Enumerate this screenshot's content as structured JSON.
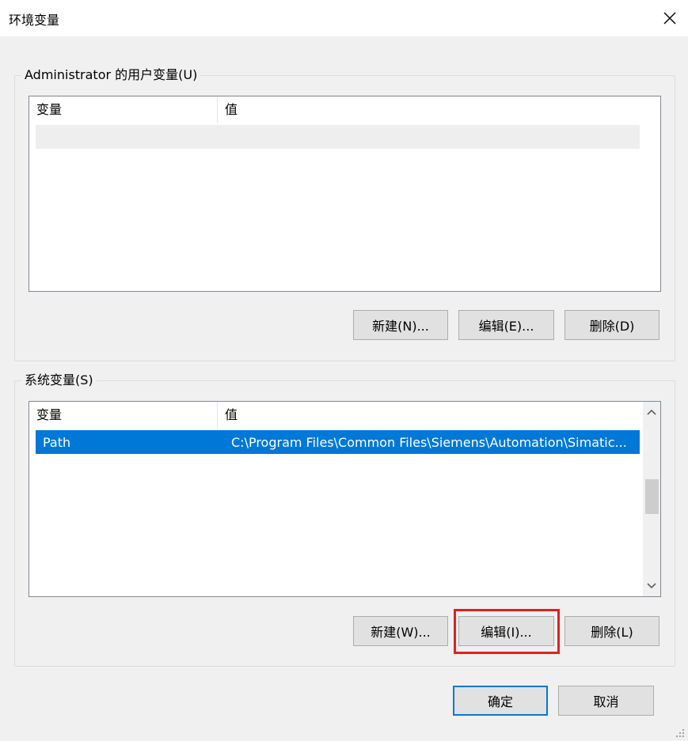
{
  "window": {
    "title": "环境变量",
    "close_icon": "close-icon"
  },
  "user_vars": {
    "group_label": "Administrator 的用户变量(U)",
    "columns": [
      "变量",
      "值"
    ],
    "rows": [],
    "buttons": {
      "new": "新建(N)...",
      "edit": "编辑(E)...",
      "delete": "删除(D)"
    }
  },
  "system_vars": {
    "group_label": "系统变量(S)",
    "columns": [
      "变量",
      "值"
    ],
    "selected_row": {
      "name": "Path",
      "value": "C:\\Program Files\\Common Files\\Siemens\\Automation\\Simatic..."
    },
    "buttons": {
      "new": "新建(W)...",
      "edit": "编辑(I)...",
      "delete": "删除(L)"
    },
    "highlighted_button": "edit"
  },
  "footer": {
    "ok": "确定",
    "cancel": "取消"
  },
  "colors": {
    "selection": "#0078d7",
    "highlight": "#e02020"
  }
}
